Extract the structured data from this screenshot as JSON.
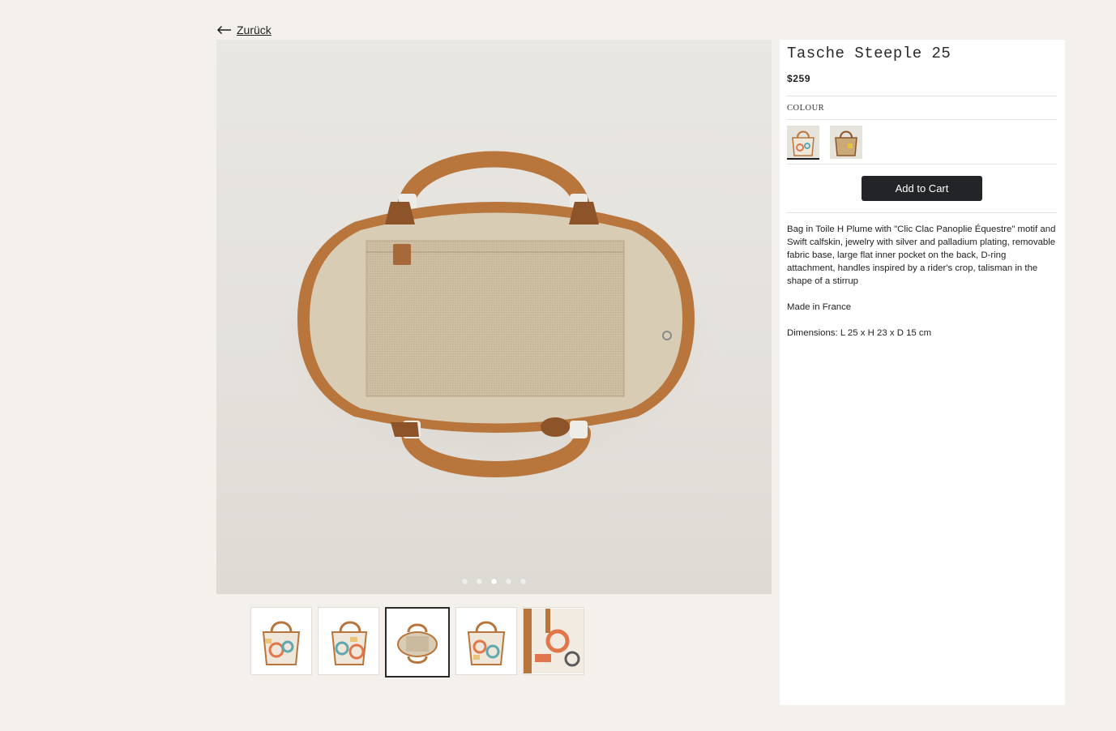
{
  "nav": {
    "back_label": "Zurück"
  },
  "gallery": {
    "dots": 5,
    "active_index": 2,
    "thumbnails": [
      {
        "name": "front"
      },
      {
        "name": "three-quarter"
      },
      {
        "name": "top-interior"
      },
      {
        "name": "back"
      },
      {
        "name": "detail"
      }
    ]
  },
  "product": {
    "title": "Tasche Steeple 25",
    "price": "$259",
    "colour_label": "COLOUR",
    "add_to_cart": "Add to Cart",
    "description": "Bag in Toile H Plume with \"Clic Clac Panoplie Équestre\" motif and Swift calfskin, jewelry with silver and palladium plating, removable fabric base, large flat inner pocket on the back, D-ring attachment, handles inspired by a rider's crop, talisman in the shape of a stirrup",
    "origin": "Made in France",
    "dimensions": "Dimensions: L 25 x H 23 x D 15 cm"
  },
  "colors": {
    "background": "#f4f1ec",
    "button": "#222427",
    "leather": "#b8763d",
    "canvas": "#d7cab3"
  }
}
